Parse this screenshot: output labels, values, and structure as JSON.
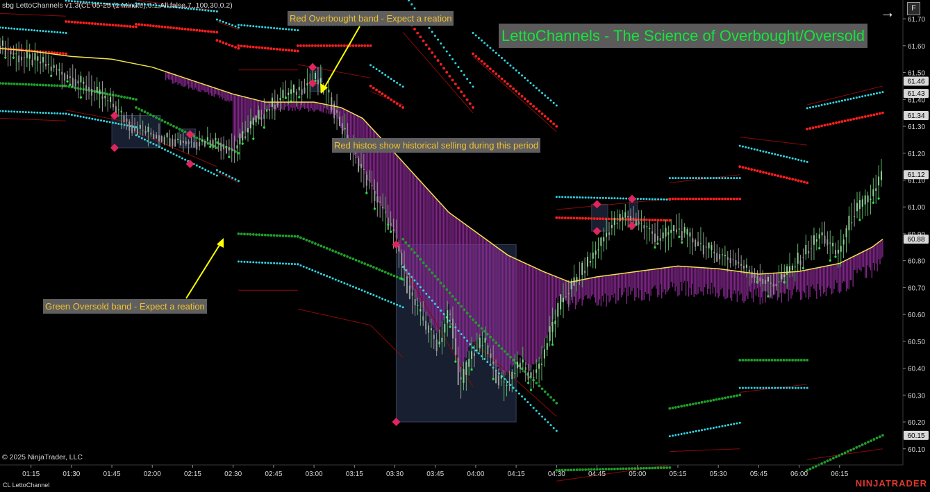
{
  "indicator_label": "sbg LettoChannels v1.3(CL 05-25 (1 Minute),0.1,All,false,7,,100,30,0.2)",
  "copyright": "© 2025 NinjaTrader, LLC",
  "footer_label": "CL LettoChannel",
  "brand": "NINJATRADER",
  "headline": "LettoChannels - The Science of Overbought/Oversold",
  "controls": {
    "nav_arrow": "→",
    "f_button": "F"
  },
  "annotations": {
    "red_band": "Red Overbought band - Expect a reation",
    "red_histos": "Red histos show historical selling during this period",
    "green_band": "Green Oversold band - Expect a reation"
  },
  "colors": {
    "background": "#000000",
    "overbought_dots": "#ff1e1e",
    "oversold_dots": "#1f9e2a",
    "outer_dots": "#30d7e6",
    "envelope": "#8b0a0a",
    "midline": "#f2e24a",
    "histogram": "#8c2a95",
    "candles": "#9a9a9a",
    "signal": "#e0245e",
    "headline_text": "#17e33c",
    "note_text": "#f2c230",
    "arrow": "#ffff00"
  },
  "chart_data": {
    "type": "line",
    "instrument": "CL 05-25",
    "interval": "1 Minute",
    "y_ticks": [
      61.7,
      61.6,
      61.5,
      61.4,
      61.3,
      61.2,
      61.1,
      61.0,
      60.9,
      60.8,
      60.7,
      60.6,
      60.5,
      60.4,
      60.3,
      60.2,
      60.1
    ],
    "y_tick_labels": [
      "61.70",
      "61.60",
      "61.50",
      "61.40",
      "61.30",
      "61.20",
      "61.10",
      "61.00",
      "60.90",
      "60.80",
      "60.70",
      "60.60",
      "60.50",
      "60.40",
      "60.30",
      "60.20",
      "60.10"
    ],
    "ylim": [
      60.04,
      61.77
    ],
    "x_ticks": [
      "01:15",
      "01:30",
      "01:45",
      "02:00",
      "02:15",
      "02:30",
      "02:45",
      "03:00",
      "03:15",
      "03:30",
      "03:45",
      "04:00",
      "04:15",
      "04:30",
      "04:45",
      "05:00",
      "05:15",
      "05:30",
      "05:45",
      "06:00",
      "06:15"
    ],
    "x_tick_minutes": [
      75,
      90,
      105,
      120,
      135,
      150,
      165,
      180,
      195,
      210,
      225,
      240,
      255,
      270,
      285,
      300,
      315,
      330,
      345,
      360,
      375
    ],
    "xlim": [
      63.5,
      398.5
    ],
    "price_markers": [
      {
        "value": 61.46,
        "label": "61.46"
      },
      {
        "value": 61.43,
        "label": "61.43"
      },
      {
        "value": 61.34,
        "label": "61.34"
      },
      {
        "value": 61.12,
        "label": "61.12"
      },
      {
        "value": 60.88,
        "label": "60.88"
      },
      {
        "value": 60.15,
        "label": "60.15"
      }
    ],
    "segments": [
      {
        "x": [
          63.5,
          88
        ],
        "ob": [
          61.59,
          61.57
        ],
        "os": [
          61.46,
          61.45
        ],
        "upper": [
          61.72,
          61.71
        ],
        "lower": [
          61.33,
          61.32
        ]
      },
      {
        "x": [
          88,
          114
        ],
        "ob": [
          61.69,
          61.67
        ],
        "os": [
          61.45,
          61.4
        ],
        "upper": [
          61.76,
          61.74
        ],
        "lower": [
          61.36,
          61.31
        ]
      },
      {
        "x": [
          114,
          144
        ],
        "ob": [
          61.68,
          61.65
        ],
        "os": [
          61.37,
          61.22
        ],
        "upper": [
          61.77,
          61.73
        ],
        "lower": [
          61.28,
          61.15
        ]
      },
      {
        "x": [
          144,
          152
        ],
        "ob": [
          61.62,
          61.59
        ],
        "os": [
          61.24,
          61.2
        ],
        "upper": [
          61.69,
          61.66
        ],
        "lower": [
          61.13,
          61.09
        ]
      },
      {
        "x": [
          152,
          174
        ],
        "ob": [
          61.6,
          61.58
        ],
        "os": [
          60.9,
          60.89
        ],
        "upper": [
          61.51,
          61.51
        ],
        "lower": [
          60.69,
          60.69
        ]
      },
      {
        "x": [
          174,
          201
        ],
        "ob": [
          61.6,
          61.6
        ],
        "os": [
          60.89,
          60.78
        ],
        "upper": [
          61.53,
          61.48
        ],
        "lower": [
          60.62,
          60.56
        ]
      },
      {
        "x": [
          201,
          213
        ],
        "ob": [
          61.45,
          61.37
        ],
        "os": [
          60.78,
          60.73
        ],
        "upper": [
          61.43,
          61.38
        ],
        "lower": [
          60.56,
          60.44
        ]
      },
      {
        "x": [
          213,
          239
        ],
        "ob": [
          61.72,
          61.37
        ],
        "os": [
          60.88,
          60.58
        ],
        "upper": [
          61.65,
          61.35
        ],
        "lower": [
          60.78,
          60.33
        ]
      },
      {
        "x": [
          239,
          270
        ],
        "ob": [
          61.57,
          61.3
        ],
        "os": [
          60.58,
          60.27
        ],
        "upper": [
          61.56,
          61.28
        ],
        "lower": [
          60.5,
          60.22
        ]
      },
      {
        "x": [
          270,
          312
        ],
        "ob": [
          60.96,
          60.95
        ],
        "os": [
          60.02,
          60.03
        ],
        "upper": [
          60.99,
          61.03
        ],
        "lower": [
          59.98,
          60.04
        ]
      },
      {
        "x": [
          312,
          338
        ],
        "ob": [
          61.03,
          61.03
        ],
        "os": [
          60.25,
          60.3
        ],
        "upper": [
          61.09,
          61.12
        ],
        "lower": [
          60.09,
          60.1
        ]
      },
      {
        "x": [
          338,
          363
        ],
        "ob": [
          61.15,
          61.09
        ],
        "os": [
          60.43,
          60.43
        ],
        "upper": [
          61.26,
          61.23
        ],
        "lower": [
          60.31,
          60.34
        ]
      },
      {
        "x": [
          363,
          391
        ],
        "ob": [
          61.29,
          61.35
        ],
        "os": [
          60.02,
          60.15
        ],
        "upper": [
          61.38,
          61.45
        ],
        "lower": [
          60.06,
          60.1
        ]
      }
    ],
    "midline": {
      "x": [
        63.5,
        75,
        90,
        105,
        120,
        135,
        150,
        162,
        172,
        180,
        190,
        198,
        210,
        230,
        252,
        265,
        275,
        285,
        300,
        315,
        330,
        345,
        360,
        375,
        387,
        391
      ],
      "y": [
        61.59,
        61.58,
        61.56,
        61.55,
        61.52,
        61.47,
        61.42,
        61.39,
        61.39,
        61.39,
        61.37,
        61.33,
        61.2,
        60.98,
        60.82,
        60.76,
        60.72,
        60.74,
        60.76,
        60.78,
        60.77,
        60.75,
        60.76,
        60.79,
        60.85,
        60.88
      ]
    },
    "signal_markers": [
      {
        "x": 106,
        "y": 61.34
      },
      {
        "x": 106,
        "y": 61.22
      },
      {
        "x": 134,
        "y": 61.27
      },
      {
        "x": 134,
        "y": 61.16
      },
      {
        "x": 179.5,
        "y": 61.52
      },
      {
        "x": 179.5,
        "y": 61.46
      },
      {
        "x": 210.5,
        "y": 60.86
      },
      {
        "x": 210.5,
        "y": 60.2
      },
      {
        "x": 285,
        "y": 61.01
      },
      {
        "x": 285,
        "y": 60.91
      },
      {
        "x": 298,
        "y": 61.03
      },
      {
        "x": 298,
        "y": 60.93
      }
    ],
    "shaded_boxes": [
      {
        "x0": 105,
        "x1": 123,
        "y0": 61.22,
        "y1": 61.34
      },
      {
        "x0": 130,
        "x1": 136,
        "y0": 61.22,
        "y1": 61.29
      },
      {
        "x0": 178.5,
        "x1": 183,
        "y0": 61.43,
        "y1": 61.52
      },
      {
        "x0": 210.5,
        "x1": 255,
        "y0": 60.2,
        "y1": 60.86
      },
      {
        "x0": 283,
        "x1": 289,
        "y0": 60.91,
        "y1": 61.01
      },
      {
        "x0": 297,
        "x1": 300,
        "y0": 60.93,
        "y1": 61.03
      }
    ],
    "price_path": {
      "x": [
        63.5,
        70,
        78,
        86,
        95,
        105,
        112,
        120,
        128,
        135,
        142,
        150,
        156,
        162,
        168,
        175,
        180,
        185,
        190,
        196,
        202,
        208,
        211,
        214,
        218,
        222,
        226,
        230,
        234,
        238,
        243,
        247,
        251,
        256,
        260,
        264,
        268,
        272,
        278,
        284,
        290,
        296,
        302,
        308,
        314,
        320,
        328,
        336,
        344,
        350,
        356,
        362,
        368,
        374,
        380,
        386,
        391
      ],
      "y": [
        61.6,
        61.56,
        61.54,
        61.5,
        61.45,
        61.38,
        61.3,
        61.27,
        61.25,
        61.24,
        61.25,
        61.21,
        61.3,
        61.36,
        61.41,
        61.44,
        61.48,
        61.42,
        61.3,
        61.17,
        61.05,
        60.93,
        60.85,
        60.72,
        60.62,
        60.55,
        60.48,
        60.62,
        60.33,
        60.45,
        60.5,
        60.38,
        60.33,
        60.43,
        60.36,
        60.42,
        60.55,
        60.66,
        60.74,
        60.83,
        60.93,
        60.97,
        60.93,
        60.88,
        60.92,
        60.88,
        60.83,
        60.8,
        60.74,
        60.71,
        60.76,
        60.83,
        60.9,
        60.82,
        60.98,
        61.03,
        61.13
      ]
    }
  }
}
